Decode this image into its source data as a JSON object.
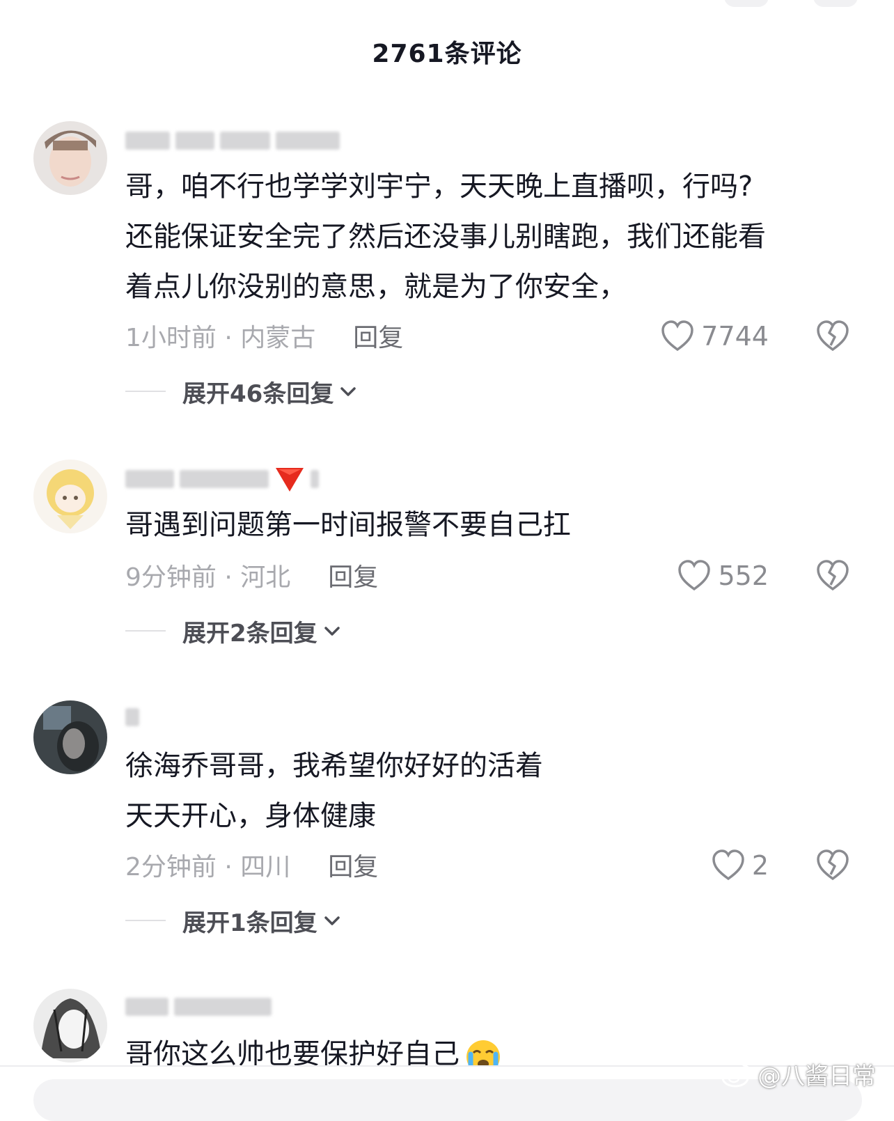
{
  "header": {
    "title": "2761条评论"
  },
  "comments": [
    {
      "text_lines": [
        "哥，咱不行也学学刘宇宁，天天晚上直播呗，行吗?",
        "还能保证安全完了然后还没事儿别瞎跑，我们还能看",
        "着点儿你没别的意思，就是为了你安全，"
      ],
      "time_location": "1小时前 · 内蒙古",
      "reply_label": "回复",
      "likes": "7744",
      "expand_label": "展开46条回复"
    },
    {
      "text_lines": [
        "哥遇到问题第一时间报警不要自己扛"
      ],
      "time_location": "9分钟前 · 河北",
      "reply_label": "回复",
      "likes": "552",
      "expand_label": "展开2条回复"
    },
    {
      "text_lines": [
        "徐海乔哥哥，我希望你好好的活着",
        "天天开心，身体健康"
      ],
      "time_location": "2分钟前 · 四川",
      "reply_label": "回复",
      "likes": "2",
      "expand_label": "展开1条回复"
    },
    {
      "text_lines": [
        "哥你这么帅也要保护好自己"
      ]
    }
  ],
  "watermark": {
    "text": "@八酱日常"
  },
  "icons": {
    "like": "heart-outline-icon",
    "dislike": "broken-heart-icon",
    "expand": "chevron-down-icon",
    "emoji": "crying-face-emoji",
    "username_emoji": "red-heart-emoji"
  },
  "colors": {
    "text": "#161823",
    "meta": "#a8a9ae",
    "reply": "#6b6c72"
  }
}
